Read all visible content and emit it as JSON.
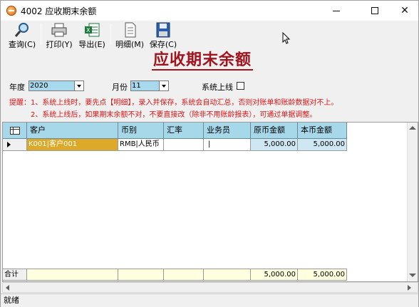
{
  "window": {
    "title": "4002 应收期末余额",
    "minimize": "—",
    "maximize": "□",
    "close": "✕"
  },
  "toolbar": {
    "query": "查询(C)",
    "print": "打印(Y)",
    "export": "导出(E)",
    "detail": "明细(M)",
    "save": "保存(C)"
  },
  "heading": "应收期末余额",
  "filters": {
    "year_label": "年度",
    "year_value": "2020",
    "month_label": "月份",
    "month_value": "11",
    "online_label": "系统上线"
  },
  "tips": {
    "line1": "提醒：1、系统上线时，要先点【明细】，录入并保存，系统会自动汇总，否则对账单和账龄数据对不上。",
    "line2": "2、系统上线后，如果期末余额不对，不要直接改（除非不用账龄报表），可通过单据调整。"
  },
  "grid": {
    "columns": [
      "客户",
      "币别",
      "汇率",
      "业务员",
      "原币金额",
      "本币金额"
    ],
    "row": {
      "customer": "K001|客户001",
      "currency": "RMB|人民币",
      "rate": "",
      "salesman": "|",
      "orig_amount": "5,000.00",
      "local_amount": "5,000.00"
    },
    "total": {
      "label": "合计",
      "orig_amount": "5,000.00",
      "local_amount": "5,000.00"
    }
  },
  "status": "就绪",
  "colors": {
    "heading": "#a0141e",
    "tip": "#e01414",
    "header_bg": "#a6d8ea",
    "customer_cell": "#dcaa28",
    "total_bg": "#ffffe0",
    "amount_bg": "#cfe6f3"
  }
}
